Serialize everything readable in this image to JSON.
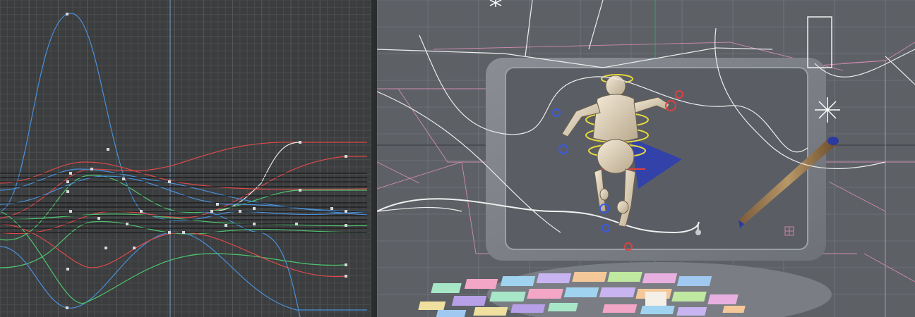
{
  "app": {
    "accent_color": "#5aa0e0",
    "graph_bg": "#3b3d3f",
    "viewport_bg": "#5d6166"
  },
  "graph_editor": {
    "curve_colors": [
      "#4a90d9",
      "#d94a4a",
      "#4ec46e",
      "#e8e8e8",
      "#1a1a1a"
    ]
  },
  "viewport": {
    "character": "mannequin-figure",
    "props": [
      "tablet",
      "stylus-pen",
      "color-palette-disc",
      "light-icon",
      "camera-frame"
    ],
    "gizmo_colors": {
      "x": "#e04040",
      "y": "#e8d840",
      "z": "#3a5ae0",
      "z_plane": "#2a3aa0"
    },
    "palette_colors": [
      "#a8e6c8",
      "#f4a6c6",
      "#9fd3f0",
      "#c8b4f0",
      "#f5c89a",
      "#bfe8a0",
      "#e8b0e0",
      "#a0c8f0",
      "#f0e0a0",
      "#b8a0e8"
    ]
  }
}
